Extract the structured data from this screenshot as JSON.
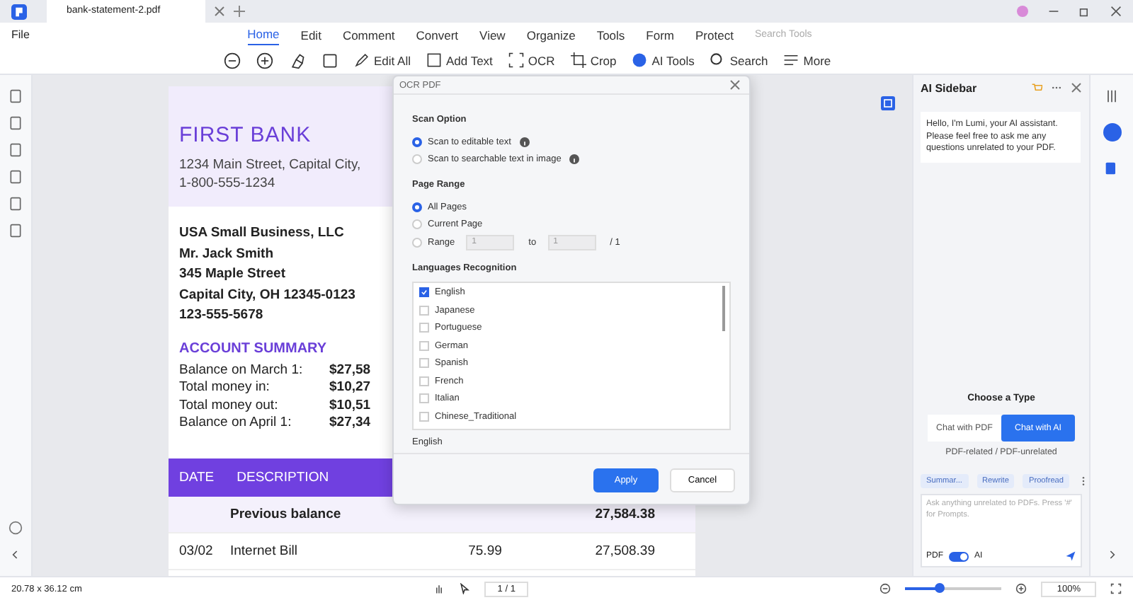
{
  "tab": {
    "title": "bank-statement-2.pdf"
  },
  "menu": {
    "file": "File",
    "items": [
      {
        "label": "Home",
        "selected": true
      },
      {
        "label": "Edit",
        "selected": false
      },
      {
        "label": "Comment",
        "selected": false
      },
      {
        "label": "Convert",
        "selected": false
      },
      {
        "label": "View",
        "selected": false
      },
      {
        "label": "Organize",
        "selected": false
      },
      {
        "label": "Tools",
        "selected": false
      },
      {
        "label": "Form",
        "selected": false
      },
      {
        "label": "Protect",
        "selected": false
      }
    ],
    "search": {
      "placeholder": "Search Tools"
    }
  },
  "toolbar": [
    {
      "kind": "zoom-out"
    },
    {
      "kind": "zoom-in"
    },
    {
      "kind": "highlight"
    },
    {
      "kind": "shape"
    },
    {
      "kind": "edit",
      "label": "Edit All"
    },
    {
      "kind": "textbox",
      "label": "Add Text"
    },
    {
      "kind": "ocr",
      "label": "OCR"
    },
    {
      "kind": "crop",
      "label": "Crop"
    },
    {
      "kind": "ai",
      "label": "AI Tools"
    },
    {
      "kind": "search",
      "label": "Search"
    },
    {
      "kind": "more",
      "label": "More"
    }
  ],
  "document": {
    "bank": "FIRST BANK",
    "address": [
      "1234 Main Street, Capital City,",
      "1-800-555-1234"
    ],
    "customer": [
      "USA Small Business, LLC",
      "Mr. Jack Smith",
      "345 Maple Street",
      "Capital City, OH 12345-0123",
      "123-555-5678"
    ],
    "summary_title": "ACCOUNT SUMMARY",
    "summary": [
      {
        "label": "Balance on March 1:",
        "value": "$27,58"
      },
      {
        "label": "Total money in:",
        "value": "$10,27"
      },
      {
        "label": "Total money out:",
        "value": "$10,51"
      },
      {
        "label": "Balance on April 1:",
        "value": "$27,34"
      }
    ],
    "columns": [
      "DATE",
      "DESCRIPTION"
    ],
    "rows": [
      {
        "date": "",
        "description": "Previous balance",
        "amount": "",
        "balance": "27,584.38"
      },
      {
        "date": "03/02",
        "description": "Internet Bill",
        "amount": "75.99",
        "balance": "27,508.39"
      }
    ]
  },
  "dialog": {
    "title": "OCR PDF",
    "scan_title": "Scan Option",
    "scan_options": [
      {
        "label": "Scan to editable text",
        "selected": true
      },
      {
        "label": "Scan to searchable text in image",
        "selected": false
      }
    ],
    "range_title": "Page Range",
    "range_options": [
      {
        "label": "All Pages",
        "selected": true
      },
      {
        "label": "Current Page",
        "selected": false
      },
      {
        "label": "Range",
        "selected": false
      }
    ],
    "range_from": "1",
    "range_to_label": "to",
    "range_to": "1",
    "range_total": "/ 1",
    "lang_title": "Languages Recognition",
    "languages": [
      {
        "label": "English",
        "checked": true
      },
      {
        "label": "Japanese",
        "checked": false
      },
      {
        "label": "Portuguese",
        "checked": false
      },
      {
        "label": "German",
        "checked": false
      },
      {
        "label": "Spanish",
        "checked": false
      },
      {
        "label": "French",
        "checked": false
      },
      {
        "label": "Italian",
        "checked": false
      },
      {
        "label": "Chinese_Traditional",
        "checked": false
      }
    ],
    "chosen": "English",
    "buttons": [
      {
        "kind": "primary",
        "label": "Apply"
      },
      {
        "kind": "secondary",
        "label": "Cancel"
      }
    ]
  },
  "sidebar": {
    "title": "AI Sidebar",
    "message": "Hello, I'm Lumi, your AI assistant. Please feel free to ask me any questions unrelated to your PDF.",
    "choose": "Choose a Type",
    "types": [
      {
        "label": "Chat with PDF",
        "selected": false
      },
      {
        "label": "Chat with AI",
        "selected": true
      }
    ],
    "caption": "PDF-related / PDF-unrelated",
    "chips": [
      "Summar...",
      "Rewrite",
      "Proofread"
    ],
    "placeholder": "Ask anything unrelated to PDFs. Press '#' for Prompts.",
    "left_label": "PDF",
    "right_label": "AI",
    "toggle_on": true
  },
  "status": {
    "size": "20.78 x 36.12 cm",
    "page": "1 / 1",
    "zoom": "100%",
    "level": 0.35
  }
}
